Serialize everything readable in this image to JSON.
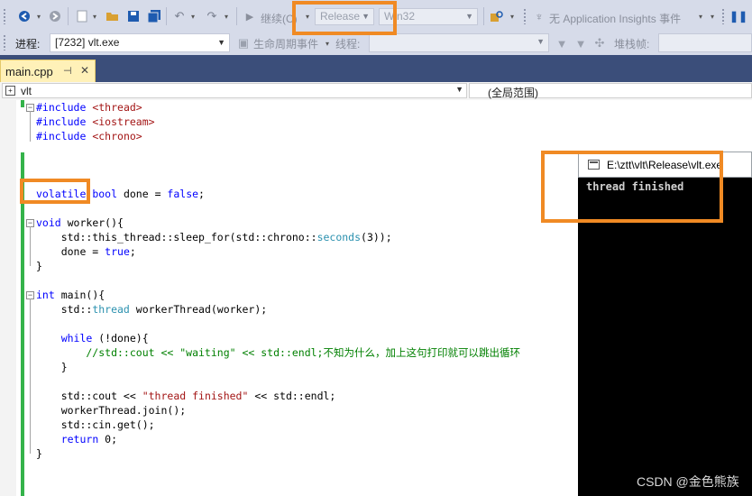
{
  "toolbar1": {
    "continue_label": "继续(C)",
    "config_value": "Release",
    "platform_value": "Win32",
    "app_insights_label": "无 Application Insights 事件"
  },
  "toolbar2": {
    "process_label": "进程:",
    "process_value": "[7232] vlt.exe",
    "lifecycle_label": "生命周期事件",
    "thread_label": "线程:",
    "stack_label": "堆栈帧:"
  },
  "tabs": [
    {
      "label": "main.cpp",
      "pin": "⊣",
      "close": "✕"
    }
  ],
  "navbar": {
    "scope_left": "vlt",
    "scope_right": "(全局范围)"
  },
  "code_lines": [
    [
      "#include <thread>"
    ],
    [
      "#include <iostream>"
    ],
    [
      "#include <chrono>"
    ],
    [
      ""
    ],
    [
      ""
    ],
    [
      "volatile bool done = false;"
    ],
    [
      ""
    ],
    [
      "void worker(){"
    ],
    [
      "    std::this_thread::sleep_for(std::chrono::seconds(3));"
    ],
    [
      "    done = true;"
    ],
    [
      "}"
    ],
    [
      ""
    ],
    [
      "int main(){"
    ],
    [
      "    std::thread workerThread(worker);"
    ],
    [
      ""
    ],
    [
      "    while (!done){"
    ],
    [
      "        //std::cout << \"waiting\" << std::endl;不知为什么，加上这句打印就可以跳出循环"
    ],
    [
      "    }"
    ],
    [
      ""
    ],
    [
      "    std::cout << \"thread finished\" << std::endl;"
    ],
    [
      "    workerThread.join();"
    ],
    [
      "    std::cin.get();"
    ],
    [
      "    return 0;"
    ],
    [
      "}"
    ]
  ],
  "console": {
    "title": "E:\\ztt\\vlt\\Release\\vlt.exe",
    "output": "thread finished"
  },
  "watermark": "CSDN @金色熊族",
  "colors": {
    "highlight": "#f08a24",
    "keyword": "#0000ff",
    "string": "#a31515",
    "comment": "#008000",
    "type": "#2b91af",
    "change_bar": "#34b34a"
  }
}
